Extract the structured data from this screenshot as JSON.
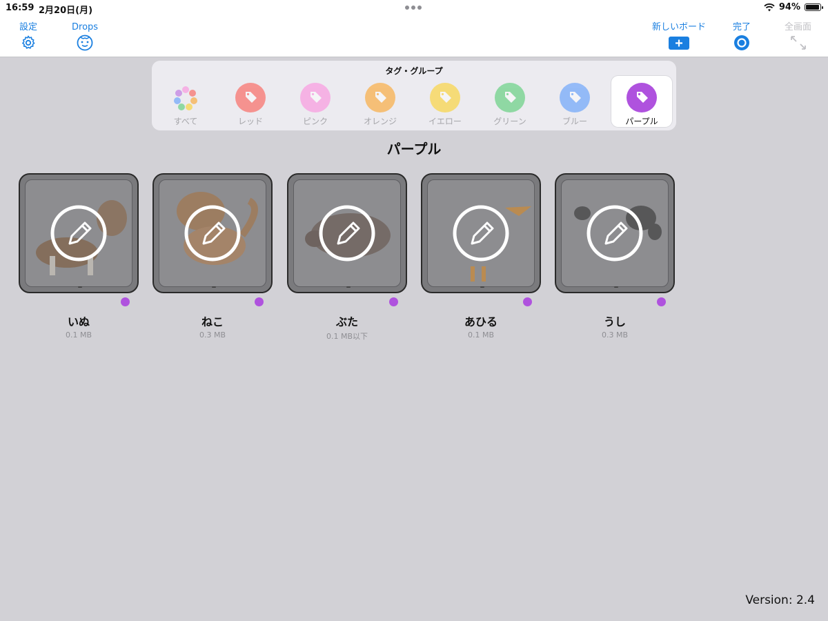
{
  "status_bar": {
    "time": "16:59",
    "date": "2月20日(月)",
    "battery": "94%",
    "battery_level": 0.94
  },
  "toolbar": {
    "settings_label": "設定",
    "drops_label": "Drops",
    "new_board_label": "新しいボード",
    "done_label": "完了",
    "fullscreen_label": "全画面"
  },
  "tag_group": {
    "title": "タグ・グループ",
    "selected": "パープル",
    "tags": [
      {
        "label": "すべて",
        "color": "#cccccc"
      },
      {
        "label": "レッド",
        "color": "#ff3b30"
      },
      {
        "label": "ピンク",
        "color": "#ff7ad9"
      },
      {
        "label": "オレンジ",
        "color": "#ff9500"
      },
      {
        "label": "イエロー",
        "color": "#ffcc00"
      },
      {
        "label": "グリーン",
        "color": "#34c759"
      },
      {
        "label": "ブルー",
        "color": "#3d8bff"
      },
      {
        "label": "パープル",
        "color": "#af52de"
      }
    ]
  },
  "section_title": "パープル",
  "boards": [
    {
      "name": "いぬ",
      "size": "0.1 MB",
      "icon": "dog-icon",
      "tag_color": "#af52de"
    },
    {
      "name": "ねこ",
      "size": "0.3 MB",
      "icon": "cat-icon",
      "tag_color": "#af52de"
    },
    {
      "name": "ぶた",
      "size": "0.1 MB以下",
      "icon": "pig-icon",
      "tag_color": "#af52de"
    },
    {
      "name": "あひる",
      "size": "0.1 MB",
      "icon": "duck-icon",
      "tag_color": "#af52de"
    },
    {
      "name": "うし",
      "size": "0.3 MB",
      "icon": "cow-icon",
      "tag_color": "#af52de"
    }
  ],
  "version": "Version: 2.4",
  "colors": {
    "accent": "#1a7fe0",
    "purple_tag": "#af52de",
    "background": "#d2d1d6"
  }
}
